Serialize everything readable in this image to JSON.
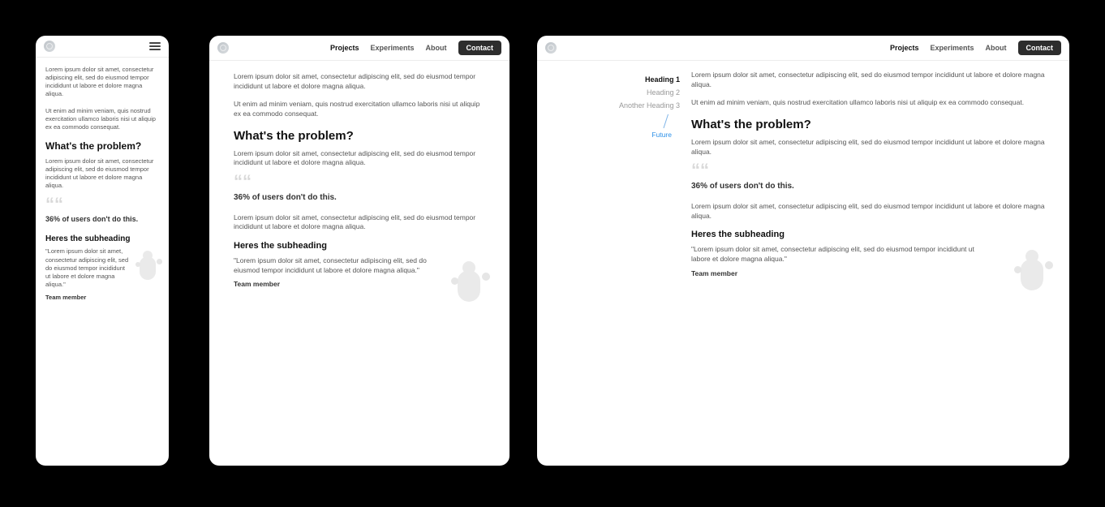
{
  "nav": {
    "items": [
      "Projects",
      "Experiments",
      "About"
    ],
    "active": "Projects",
    "contact": "Contact"
  },
  "toc": {
    "items": [
      "Heading 1",
      "Heading 2",
      "Another Heading 3"
    ],
    "active_index": 0,
    "future": "Future"
  },
  "content": {
    "intro1": "Lorem ipsum dolor sit amet, consectetur adipiscing elit, sed do eiusmod tempor incididunt ut labore et dolore magna aliqua.",
    "intro2": "Ut enim ad minim veniam, quis nostrud exercitation ullamco laboris nisi ut aliquip ex ea commodo consequat.",
    "h2": "What's the problem?",
    "after_h2": "Lorem ipsum dolor sit amet, consectetur adipiscing elit, sed do eiusmod tempor incididunt ut labore et dolore magna aliqua.",
    "quote_glyph": "““",
    "stat": "36% of users don't do this.",
    "after_stat": "Lorem ipsum dolor sit amet, consectetur adipiscing elit, sed do eiusmod tempor incididunt ut labore et dolore magna aliqua.",
    "h3": "Heres the subheading",
    "testimonial_quote": "\"Lorem ipsum dolor sit amet, consectetur adipiscing elit, sed do eiusmod tempor incididunt ut labore et dolore magna aliqua.\"",
    "team": "Team member"
  }
}
